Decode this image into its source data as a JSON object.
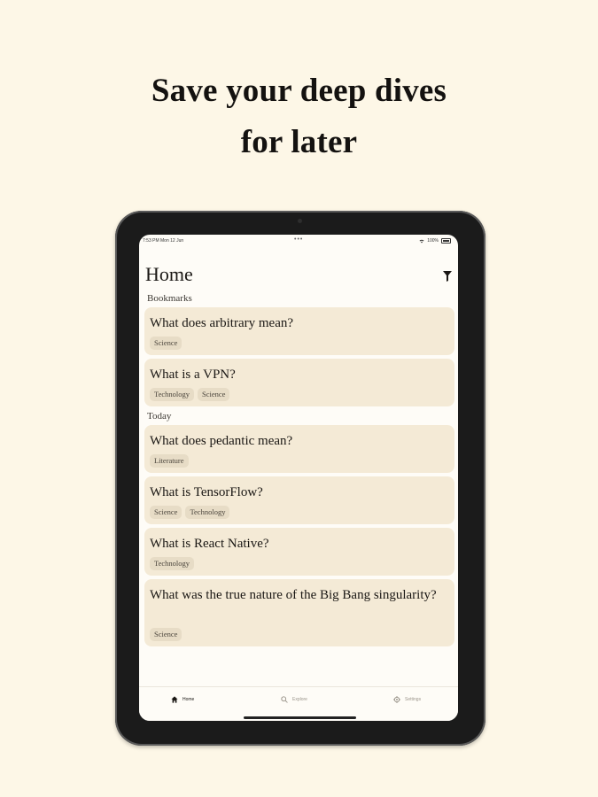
{
  "headline": {
    "line1": "Save your deep dives",
    "line2": "for later"
  },
  "status_bar": {
    "time_date": "7:53 PM   Mon 12 Jun",
    "center": "•••",
    "battery_text": "100%",
    "icons": [
      "wifi-icon",
      "battery-icon"
    ]
  },
  "app": {
    "title": "Home",
    "filter_icon": "filter-icon",
    "sections": [
      {
        "label": "Bookmarks",
        "items": [
          {
            "title": "What does arbitrary mean?",
            "tags": [
              "Science"
            ]
          },
          {
            "title": "What is a VPN?",
            "tags": [
              "Technology",
              "Science"
            ]
          }
        ]
      },
      {
        "label": "Today",
        "items": [
          {
            "title": "What does pedantic mean?",
            "tags": [
              "Literature"
            ]
          },
          {
            "title": "What is TensorFlow?",
            "tags": [
              "Science",
              "Technology"
            ]
          },
          {
            "title": "What is React Native?",
            "tags": [
              "Technology"
            ]
          },
          {
            "title": "What was the true nature of the Big Bang singularity?",
            "tags": [
              "Science"
            ]
          }
        ]
      }
    ]
  },
  "tab_bar": {
    "tabs": [
      {
        "label": "Home",
        "icon": "home-icon",
        "active": true
      },
      {
        "label": "Explore",
        "icon": "search-icon",
        "active": false
      },
      {
        "label": "Settings",
        "icon": "gear-icon",
        "active": false
      }
    ]
  },
  "colors": {
    "page_background": "#fdf7e7",
    "card_background": "#f4ead6",
    "tag_background": "#e7dcc6",
    "device_frame": "#1b1b1b"
  }
}
